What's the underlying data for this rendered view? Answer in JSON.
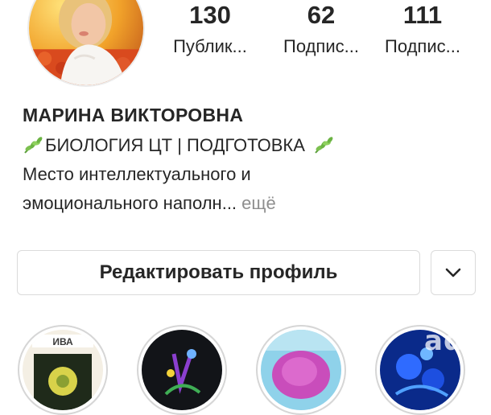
{
  "profile": {
    "name": "МАРИНА ВИКТОРОВНА",
    "bio_line1": "БИОЛОГИЯ ЦТ | ПОДГОТОВКА",
    "bio_line2": "Место интеллектуального и",
    "bio_line3": "эмоционального наполн...",
    "more_label": "ещё"
  },
  "stats": [
    {
      "value": "130",
      "label": "Публик..."
    },
    {
      "value": "62",
      "label": "Подпис..."
    },
    {
      "value": "111",
      "label": "Подпис..."
    }
  ],
  "buttons": {
    "edit_profile": "Редактировать профиль"
  },
  "highlights": [
    {
      "label": "ИВА"
    },
    {
      "label": ""
    },
    {
      "label": ""
    },
    {
      "label": ""
    }
  ],
  "watermark": "ade",
  "icons": {
    "leaf": "leaf-emoji-icon",
    "dropdown": "chevron-down-icon"
  }
}
